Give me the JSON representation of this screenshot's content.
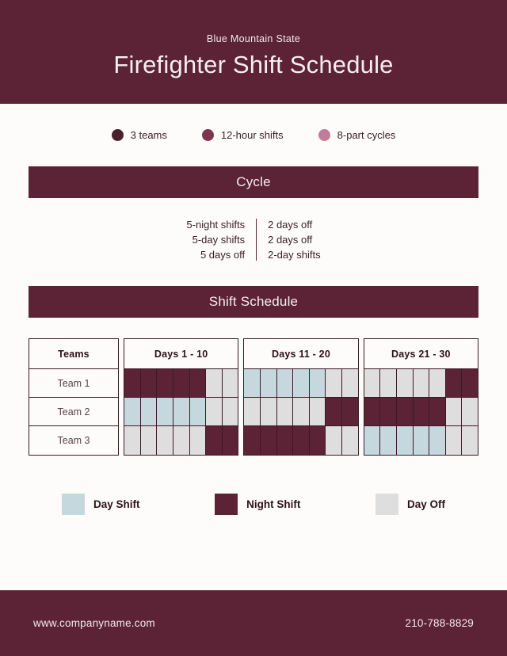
{
  "header": {
    "subtitle": "Blue Mountain State",
    "title": "Firefighter Shift Schedule"
  },
  "highlights": [
    {
      "label": "3 teams",
      "color": "#4a1f2e",
      "dot": "filled-circle-icon"
    },
    {
      "label": "12-hour shifts",
      "color": "#7d3650",
      "dot": "filled-circle-icon"
    },
    {
      "label": "8-part cycles",
      "color": "#c07d99",
      "dot": "filled-circle-icon"
    }
  ],
  "cycle": {
    "band_title": "Cycle",
    "left_column": [
      "5-night shifts",
      "5-day shifts",
      "5 days off"
    ],
    "right_column": [
      "2 days off",
      "2 days off",
      "2-day shifts"
    ]
  },
  "schedule": {
    "band_title": "Shift Schedule",
    "teams_header": "Teams",
    "teams": [
      "Team 1",
      "Team 2",
      "Team 3"
    ],
    "day_ranges": [
      "Days 1 - 10",
      "Days 11 - 20",
      "Days 21 - 30"
    ],
    "blocks": [
      {
        "range": "Days 1 - 10",
        "rows": [
          [
            "night",
            "night",
            "night",
            "night",
            "night",
            "off",
            "off"
          ],
          [
            "day",
            "day",
            "day",
            "day",
            "day",
            "off",
            "off"
          ],
          [
            "off",
            "off",
            "off",
            "off",
            "off",
            "night",
            "night"
          ]
        ]
      },
      {
        "range": "Days 11 - 20",
        "rows": [
          [
            "day",
            "day",
            "day",
            "day",
            "day",
            "off",
            "off"
          ],
          [
            "off",
            "off",
            "off",
            "off",
            "off",
            "night",
            "night"
          ],
          [
            "night",
            "night",
            "night",
            "night",
            "night",
            "off",
            "off"
          ]
        ]
      },
      {
        "range": "Days 21 - 30",
        "rows": [
          [
            "off",
            "off",
            "off",
            "off",
            "off",
            "night",
            "night"
          ],
          [
            "night",
            "night",
            "night",
            "night",
            "night",
            "off",
            "off"
          ],
          [
            "day",
            "day",
            "day",
            "day",
            "day",
            "off",
            "off"
          ]
        ]
      }
    ]
  },
  "legend": [
    {
      "label": "Day Shift",
      "color": "#c5d8de",
      "key": "day"
    },
    {
      "label": "Night Shift",
      "color": "#5c2336",
      "key": "night"
    },
    {
      "label": "Day Off",
      "color": "#dedede",
      "key": "off"
    }
  ],
  "footer": {
    "website": "www.companyname.com",
    "phone": "210-788-8829"
  },
  "theme": {
    "brand": "#5c2336",
    "background": "#fdfcfb",
    "ink": "#2e1118"
  }
}
